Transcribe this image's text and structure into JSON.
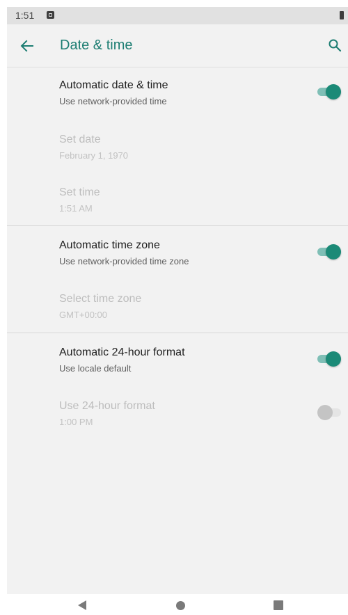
{
  "status_bar": {
    "time": "1:51",
    "notification_icon": "a-box-icon",
    "battery_icon": "battery-icon"
  },
  "app_bar": {
    "title": "Date & time",
    "back_icon": "arrow-left-icon",
    "search_icon": "search-icon"
  },
  "settings": {
    "auto_date_time": {
      "title": "Automatic date & time",
      "summary": "Use network-provided time",
      "enabled": true,
      "switch_on": true
    },
    "set_date": {
      "title": "Set date",
      "summary": "February 1, 1970",
      "enabled": false
    },
    "set_time": {
      "title": "Set time",
      "summary": "1:51 AM",
      "enabled": false
    },
    "auto_time_zone": {
      "title": "Automatic time zone",
      "summary": "Use network-provided time zone",
      "enabled": true,
      "switch_on": true
    },
    "select_time_zone": {
      "title": "Select time zone",
      "summary": "GMT+00:00",
      "enabled": false
    },
    "auto_24_hour": {
      "title": "Automatic 24-hour format",
      "summary": "Use locale default",
      "enabled": true,
      "switch_on": true
    },
    "use_24_hour": {
      "title": "Use 24-hour format",
      "summary": "1:00 PM",
      "enabled": false,
      "switch_on": false
    }
  },
  "nav_bar": {
    "back_icon": "triangle-back-icon",
    "home_icon": "circle-home-icon",
    "recents_icon": "square-recents-icon"
  },
  "colors": {
    "accent": "#1c7d72",
    "switch_thumb_on": "#1b8a77",
    "switch_track_on": "#7fbfb6",
    "background": "#f2f2f2"
  }
}
